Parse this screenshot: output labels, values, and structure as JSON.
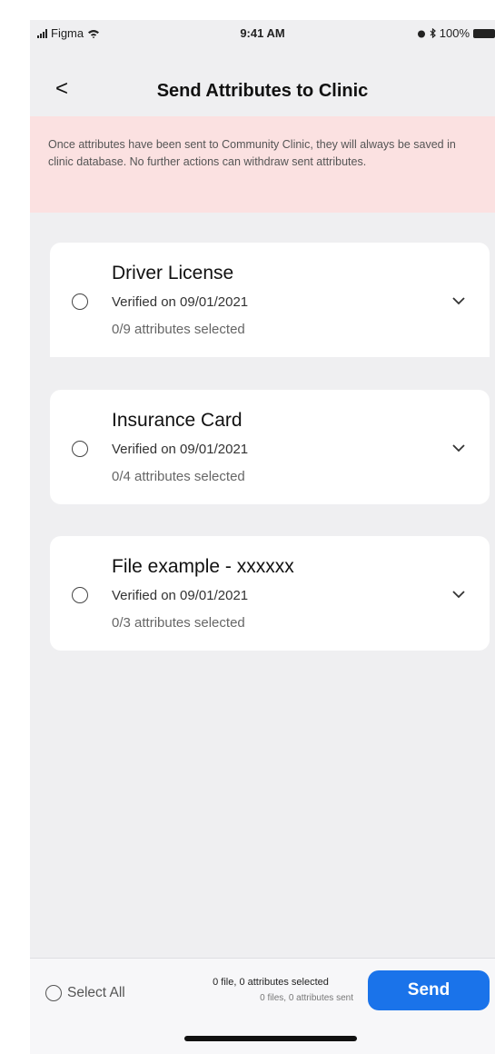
{
  "status_bar": {
    "carrier": "Figma",
    "time": "9:41 AM",
    "battery": "100%"
  },
  "nav": {
    "back": "<",
    "title": "Send Attributes to Clinic"
  },
  "warning": {
    "text": "Once attributes have been sent to Community Clinic, they will always be saved in clinic database. No further actions can withdraw sent attributes."
  },
  "documents": [
    {
      "title": "Driver License",
      "verified": "Verified on 09/01/2021",
      "count": "0/9 attributes selected"
    },
    {
      "title": "Insurance Card",
      "verified": "Verified on 09/01/2021",
      "count": "0/4 attributes selected"
    },
    {
      "title": "File example - xxxxxx",
      "verified": "Verified on 09/01/2021",
      "count": "0/3 attributes selected"
    }
  ],
  "footer": {
    "select_all": "Select All",
    "selected_summary": "0 file, 0 attributes selected",
    "sent_summary": "0 files, 0 attributes sent",
    "send_label": "Send"
  },
  "colors": {
    "accent": "#1a73ea",
    "warning_bg": "#fbe1e1",
    "background": "#efeff1"
  }
}
